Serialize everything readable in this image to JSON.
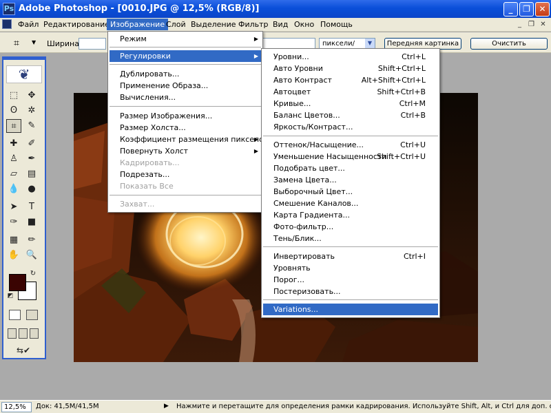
{
  "window": {
    "title": "Adobe Photoshop - [0010.JPG @ 12,5% (RGB/8)]",
    "controls": {
      "minimize": "_",
      "maximize": "❐",
      "close": "✕"
    }
  },
  "menubar": [
    "Файл",
    "Редактирование",
    "Изображение",
    "Слой",
    "Выделение",
    "Фильтр",
    "Вид",
    "Окно",
    "Помощь"
  ],
  "options_bar": {
    "width_label": "Ширина:",
    "resolution_unit": "пиксели/дюйм",
    "front_image_button": "Передняя картинка",
    "clear_button": "Очистить"
  },
  "image_menu": {
    "mode": "Режим",
    "adjustments": "Регулировки",
    "duplicate": "Дублировать...",
    "apply_image": "Применение Образа...",
    "calculations": "Вычисления...",
    "image_size": "Размер Изображения...",
    "canvas_size": "Размер Холста...",
    "pixel_aspect": "Коэффициент размещения пикселов",
    "rotate_canvas": "Повернуть Холст",
    "crop": "Кадрировать...",
    "trim": "Подрезать...",
    "reveal_all": "Показать Все",
    "trap": "Захват..."
  },
  "adjustments_menu": {
    "levels": "Уровни...",
    "levels_sc": "Ctrl+L",
    "auto_levels": "Авто Уровни",
    "auto_levels_sc": "Shift+Ctrl+L",
    "auto_contrast": "Авто Контраст",
    "auto_contrast_sc": "Alt+Shift+Ctrl+L",
    "auto_color": "Автоцвет",
    "auto_color_sc": "Shift+Ctrl+B",
    "curves": "Кривые...",
    "curves_sc": "Ctrl+M",
    "color_balance": "Баланс Цветов...",
    "color_balance_sc": "Ctrl+B",
    "brightness_contrast": "Яркость/Контраст...",
    "hue_saturation": "Оттенок/Насыщение...",
    "hue_saturation_sc": "Ctrl+U",
    "desaturate": "Уменьшение Насыщенности",
    "desaturate_sc": "Shift+Ctrl+U",
    "match_color": "Подобрать цвет...",
    "replace_color": "Замена Цвета...",
    "selective_color": "Выборочный Цвет...",
    "channel_mixer": "Смешение Каналов...",
    "gradient_map": "Карта Градиента...",
    "photo_filter": "Фото-фильтр...",
    "shadow_highlight": "Тень/Блик...",
    "invert": "Инвертировать",
    "invert_sc": "Ctrl+I",
    "equalize": "Уровнять",
    "threshold": "Порог...",
    "posterize": "Постеризовать...",
    "variations": "Variations..."
  },
  "status": {
    "zoom": "12,5%",
    "doc": "Док: 41,5M/41,5M",
    "hint": "Нажмите и перетащите для определения рамки кадрирования. Используйте Shift, Alt, и Ctrl для доп. опций."
  },
  "colors": {
    "titlebar": "#0a4fd9",
    "menu_highlight": "#316ac5",
    "foreground": "#3a0402",
    "background": "#ffffff",
    "workspace": "#aaaaaa"
  }
}
